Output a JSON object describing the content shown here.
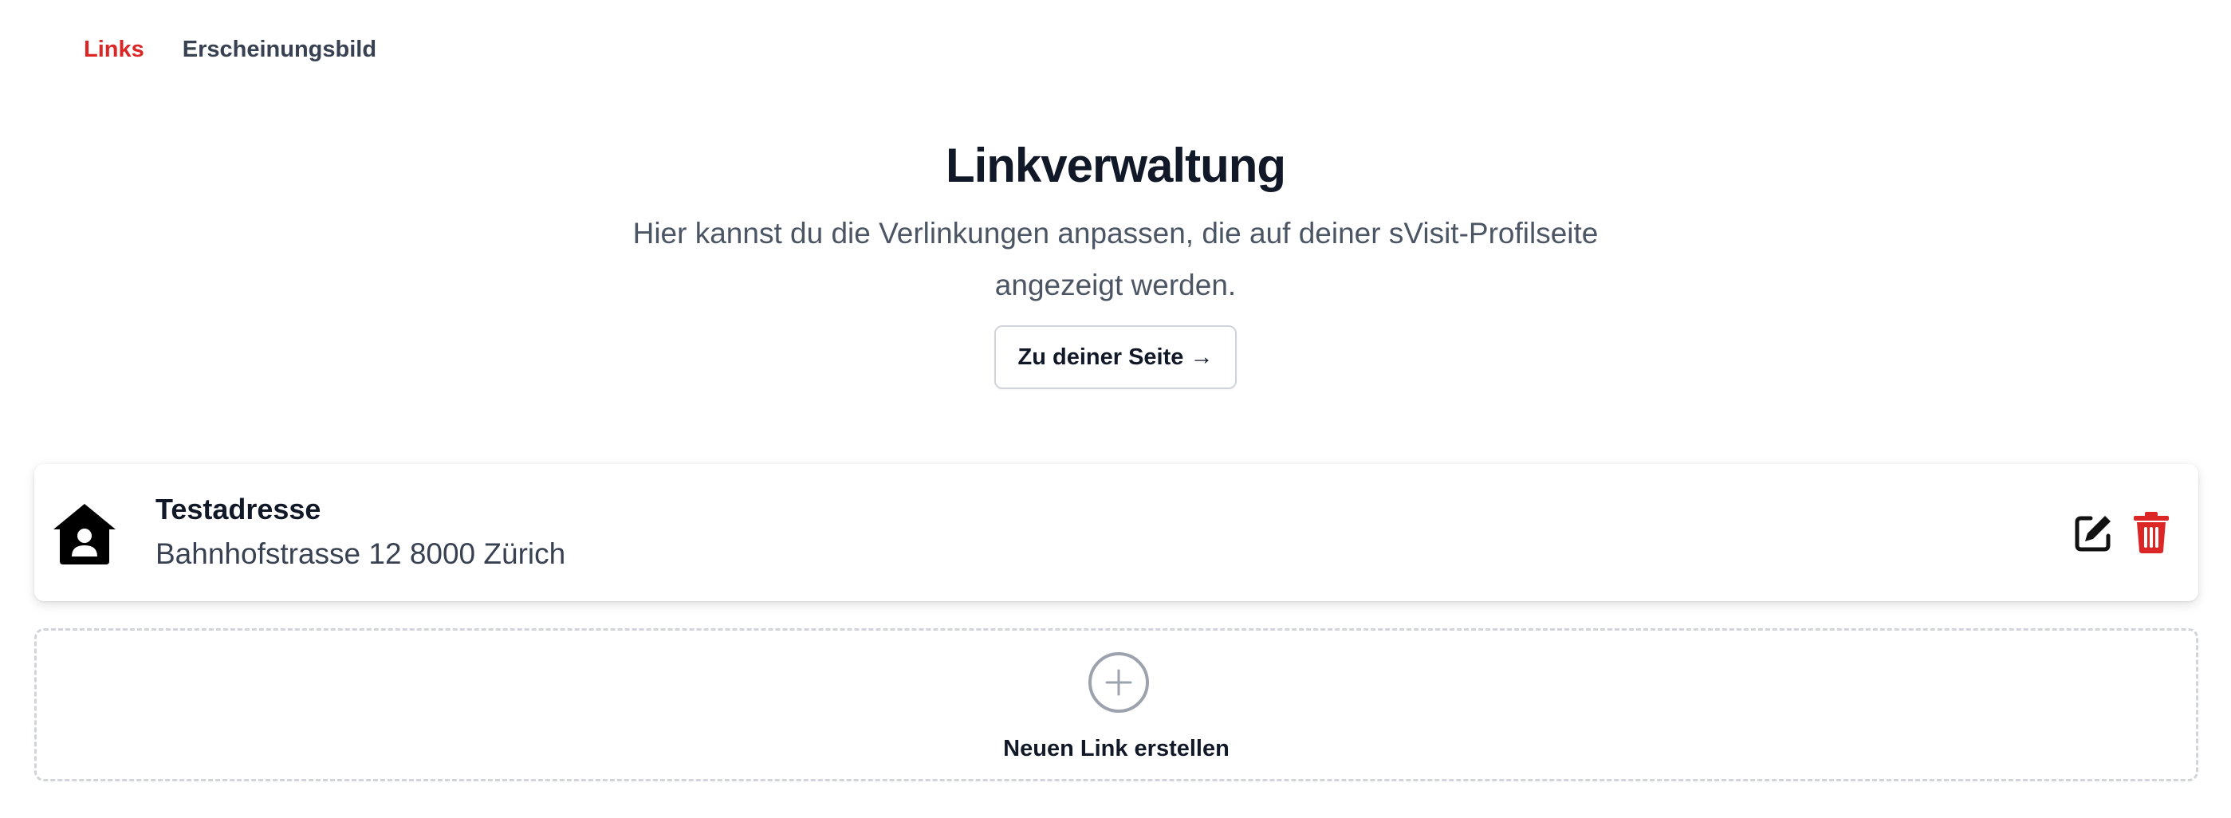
{
  "tabs": [
    {
      "label": "Links",
      "active": true
    },
    {
      "label": "Erscheinungsbild",
      "active": false
    }
  ],
  "hero": {
    "title": "Linkverwaltung",
    "description": "Hier kannst du die Verlinkungen anpassen, die auf deiner sVisit-Profilseite angezeigt werden.",
    "button_label": "Zu deiner Seite →"
  },
  "links": [
    {
      "icon": "home-user-icon",
      "title": "Testadresse",
      "subtitle": "Bahnhofstrasse 12 8000 Zürich"
    }
  ],
  "new_link": {
    "icon": "plus-circle-icon",
    "label": "Neuen Link erstellen"
  },
  "colors": {
    "accent": "#dc2626",
    "text": "#111827",
    "muted": "#4b5563",
    "border": "#d1d5db"
  }
}
